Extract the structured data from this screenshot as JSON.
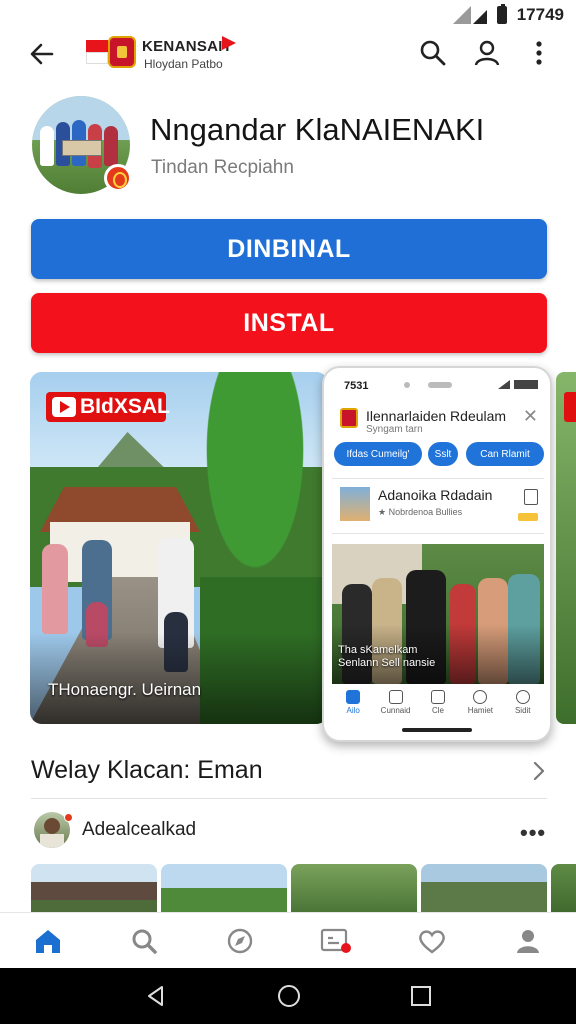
{
  "status": {
    "time": "17749"
  },
  "topbar": {
    "brand_line1": "KENANSAIT",
    "brand_line2": "Hloydan Patbo"
  },
  "app": {
    "title": "Nngandar KlaNAIENAKI",
    "subtitle": "Tindan Recpiahn",
    "primary_button": "DINBINAL",
    "install_button": "INSTAL"
  },
  "screenshots": {
    "first": {
      "badge": "BIdXSAL",
      "caption": "THonaengr. Ueirnan"
    },
    "phone": {
      "status_time": "7531",
      "title": "Ilennarlaiden Rdeulam",
      "subtitle": "Syngam tarn",
      "chips": [
        "Ifdas Cumeilg'",
        "Sslt",
        "Can Rlamit"
      ],
      "card_title": "Adanoika Rdadain",
      "card_subtitle": "★ Nobrdenoa Bullies",
      "photo_caption": "Tha sKamelkam Senlann Sell nansie",
      "nav": [
        "Ailo",
        "Cunnaid",
        "Cle",
        "Hamiet",
        "Sidit"
      ]
    }
  },
  "section": {
    "title": "Welay Klacan: Eman",
    "post_author": "Adealcealkad",
    "more": "•••"
  },
  "colors": {
    "primary_blue": "#1f6fd6",
    "install_red": "#f3121b",
    "active_nav": "#1a6fd0"
  },
  "bottom_nav_icons": [
    "home-icon",
    "search-icon",
    "explore-icon",
    "updates-icon",
    "favorites-icon",
    "profile-icon"
  ]
}
